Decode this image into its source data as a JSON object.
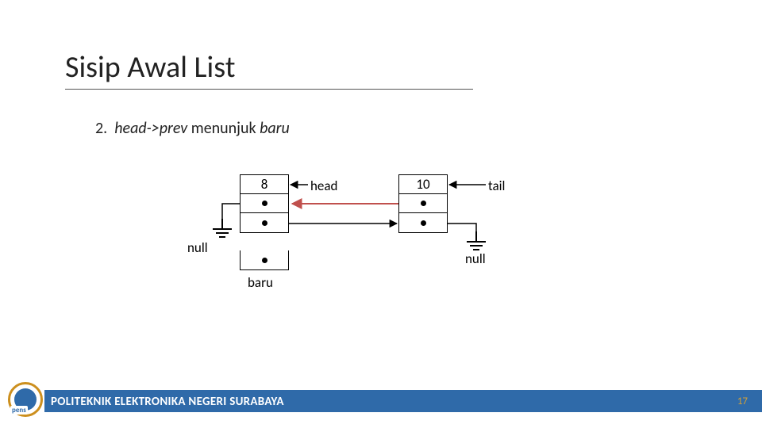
{
  "title": "Sisip Awal List",
  "step": {
    "num": "2.",
    "ital1": "head->prev",
    "plain": "menunjuk",
    "ital2": "baru"
  },
  "node1": {
    "value": "8"
  },
  "node2": {
    "value": "10"
  },
  "labels": {
    "head": "head",
    "tail": "tail",
    "null_left": "null",
    "null_right": "null",
    "baru": "baru"
  },
  "footer": {
    "org": "POLITEKNIK ELEKTRONIKA NEGERI SURABAYA",
    "page": "17"
  },
  "logo": {
    "text": "pens"
  }
}
